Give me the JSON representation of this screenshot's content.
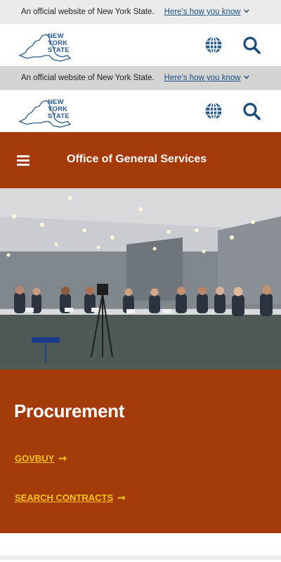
{
  "banner": {
    "message": "An official website of New York State.",
    "how_link": "Here's how you know"
  },
  "logo": {
    "line1": "NEW",
    "line2": "YORK",
    "line3": "STATE"
  },
  "icons": {
    "globe": "globe-icon",
    "search": "search-icon",
    "menu": "hamburger-menu-icon",
    "chevron": "chevron-down-icon",
    "arrow": "arrow-right-icon"
  },
  "agency": {
    "title": "Office of General Services"
  },
  "promo": {
    "heading": "Procurement",
    "links": [
      {
        "label": "GOVBUY",
        "arrow": "➞"
      },
      {
        "label": "SEARCH CONTRACTS",
        "arrow": "➞"
      }
    ]
  },
  "colors": {
    "brand_orange": "#a53a0a",
    "link_yellow": "#f5c518",
    "nys_blue": "#2b5b8f",
    "banner_link": "#1a4f86"
  }
}
